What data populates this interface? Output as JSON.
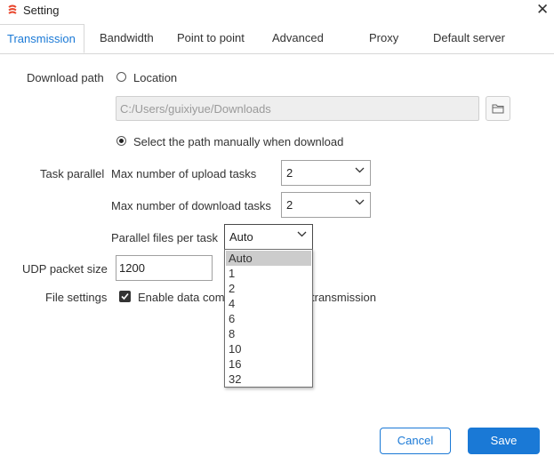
{
  "window": {
    "title": "Setting",
    "icon": "app-logo-icon",
    "close_icon": "close-icon"
  },
  "tabs": [
    {
      "label": "Transmission",
      "active": true
    },
    {
      "label": "Bandwidth"
    },
    {
      "label": "Point to point"
    },
    {
      "label": "Advanced"
    },
    {
      "label": "Proxy"
    },
    {
      "label": "Default server"
    }
  ],
  "download_path": {
    "label": "Download path",
    "location_option": "Location",
    "path_value": "C:/Users/guixiyue/Downloads",
    "manual_option": "Select the path manually when download",
    "folder_icon": "folder-icon"
  },
  "task_parallel": {
    "label": "Task parallel",
    "upload_label": "Max number of upload tasks",
    "upload_value": "2",
    "download_label": "Max number of download tasks",
    "download_value": "2",
    "files_label": "Parallel files per task",
    "files_value": "Auto",
    "files_options": [
      "Auto",
      "1",
      "2",
      "4",
      "6",
      "8",
      "10",
      "16",
      "32"
    ]
  },
  "udp": {
    "label": "UDP packet size",
    "value": "1200"
  },
  "file_settings": {
    "label": "File settings",
    "checkbox_visible_start": "Enable data com",
    "checkbox_visible_end": "transmission",
    "checked": true
  },
  "buttons": {
    "cancel": "Cancel",
    "save": "Save"
  },
  "colors": {
    "accent": "#1a79d6",
    "dropdown_selected": "#cccccc"
  }
}
